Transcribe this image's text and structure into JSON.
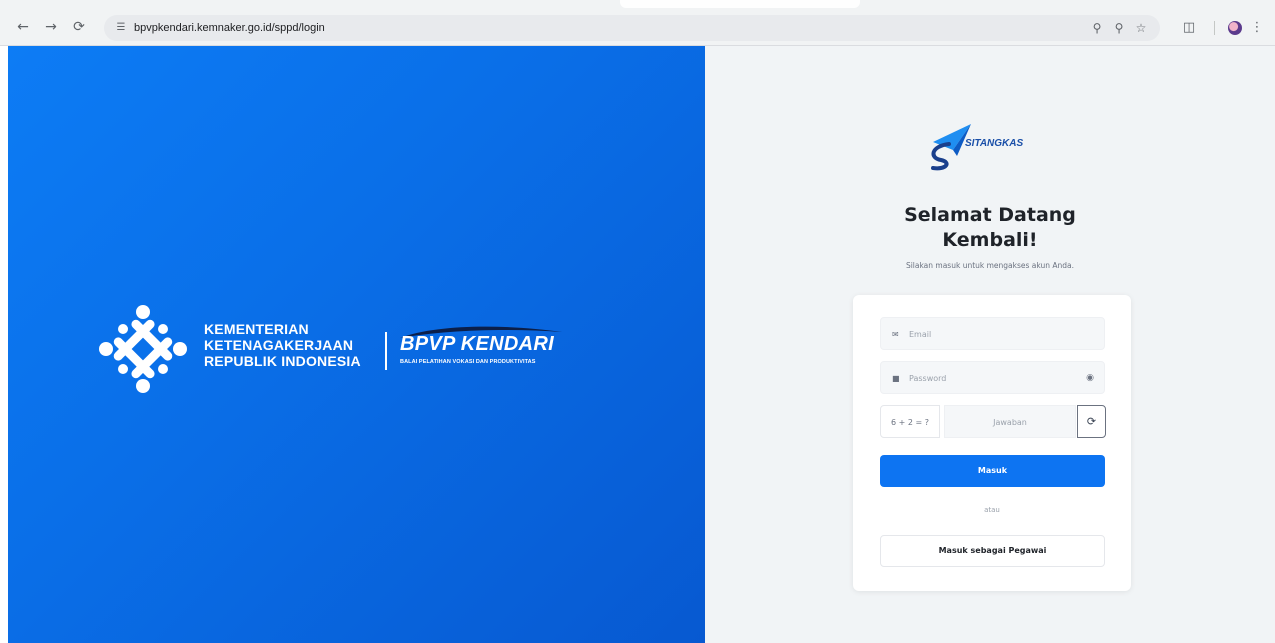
{
  "browser": {
    "back_icon": "arrow-left-icon",
    "forward_icon": "arrow-right-icon",
    "reload_icon": "reload-icon",
    "url": "bpvpkendari.kemnaker.go.id/sppd/login",
    "icons": [
      "password-key-icon",
      "zoom-icon",
      "star-icon",
      "extensions-icon",
      "profile-avatar",
      "kebab-menu-icon"
    ]
  },
  "left_panel": {
    "ministry_line1": "KEMENTERIAN",
    "ministry_line2": "KETENAGAKERJAAN",
    "ministry_line3": "REPUBLIK INDONESIA",
    "bpvp_title": "BPVP KENDARI",
    "bpvp_subtitle": "BALAI PELATIHAN VOKASI DAN PRODUKTIVITAS",
    "background_color": "#0a6fe8"
  },
  "right_panel": {
    "brand_name": "SITANGKAS",
    "welcome_line1": "Selamat Datang",
    "welcome_line2": "Kembali!",
    "welcome_sub": "Silakan masuk untuk mengakses akun Anda.",
    "form": {
      "email_placeholder": "Email",
      "password_placeholder": "Password",
      "captcha_question": "6 + 2 = ?",
      "captcha_placeholder": "Jawaban",
      "submit_label": "Masuk",
      "or_label": "atau",
      "employee_login_label": "Masuk sebagai Pegawai"
    },
    "accent_color": "#0d74f2"
  }
}
